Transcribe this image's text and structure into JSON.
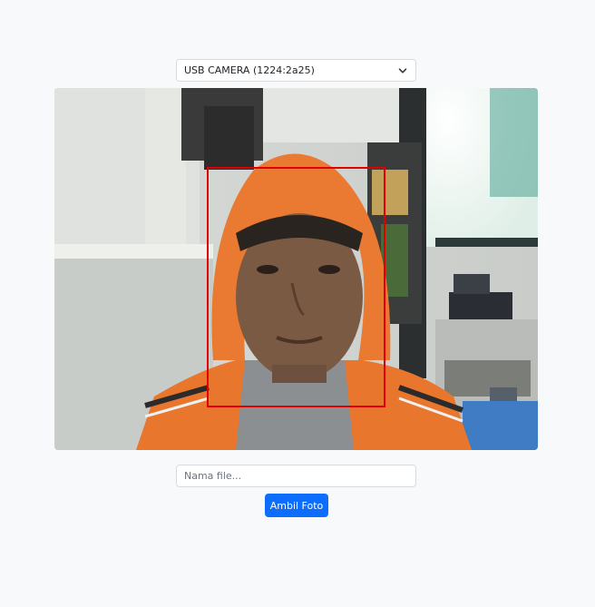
{
  "camera": {
    "selected_label": "USB CAMERA (1224:2a25)"
  },
  "filename": {
    "placeholder": "Nama file...",
    "value": ""
  },
  "capture": {
    "button_label": "Ambil Foto"
  },
  "colors": {
    "face_box": "#e00000",
    "primary_button": "#0d6efd",
    "page_background": "#f8f9fb"
  }
}
